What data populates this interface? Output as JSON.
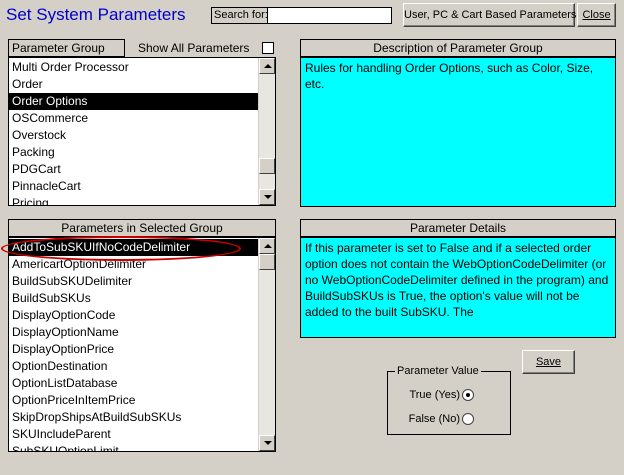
{
  "title": "Set System Parameters",
  "search": {
    "label": "Search for:",
    "value": ""
  },
  "buttons": {
    "user_pc_cart": "User, PC & Cart Based Parameters",
    "close": "Close",
    "save": "Save"
  },
  "group_panel": {
    "header": "Parameter Group",
    "show_all_label": "Show All Parameters",
    "show_all_checked": false,
    "items": [
      "Multi Order Processor",
      "Order",
      "Order Options",
      "OSCommerce",
      "Overstock",
      "Packing",
      "PDGCart",
      "PinnacleCart",
      "Pricing"
    ],
    "selected": "Order Options"
  },
  "description": {
    "header": "Description of Parameter Group",
    "text": "Rules for handling Order Options, such as Color, Size, etc."
  },
  "params_panel": {
    "header": "Parameters in Selected Group",
    "items": [
      "AddToSubSKUIfNoCodeDelimiter",
      "AmericartOptionDelimiter",
      "BuildSubSKUDelimiter",
      "BuildSubSKUs",
      "DisplayOptionCode",
      "DisplayOptionName",
      "DisplayOptionPrice",
      "OptionDestination",
      "OptionListDatabase",
      "OptionPriceInItemPrice",
      "SkipDropShipsAtBuildSubSKUs",
      "SKUIncludeParent",
      "SubSKUOptionLimit"
    ],
    "selected": "AddToSubSKUIfNoCodeDelimiter"
  },
  "details": {
    "header": "Parameter Details",
    "text": "If this parameter is set to False and if a selected order option does not contain the WebOptionCodeDelimiter (or no WebOptionCodeDelimiter defined in the program) and BuildSubSKUs is True, the option's value will not be added to the built SubSKU. The"
  },
  "parameter_value": {
    "legend": "Parameter Value",
    "true_label": "True (Yes)",
    "false_label": "False (No)",
    "selected": "true"
  },
  "colors": {
    "title": "#0000c8",
    "panel_bg": "#00ffff",
    "window_bg": "#d4d0c8",
    "highlight_ring": "#d00000"
  },
  "scroll": {
    "group_list_fraction": 0.85,
    "param_list_fraction": 0.0
  }
}
